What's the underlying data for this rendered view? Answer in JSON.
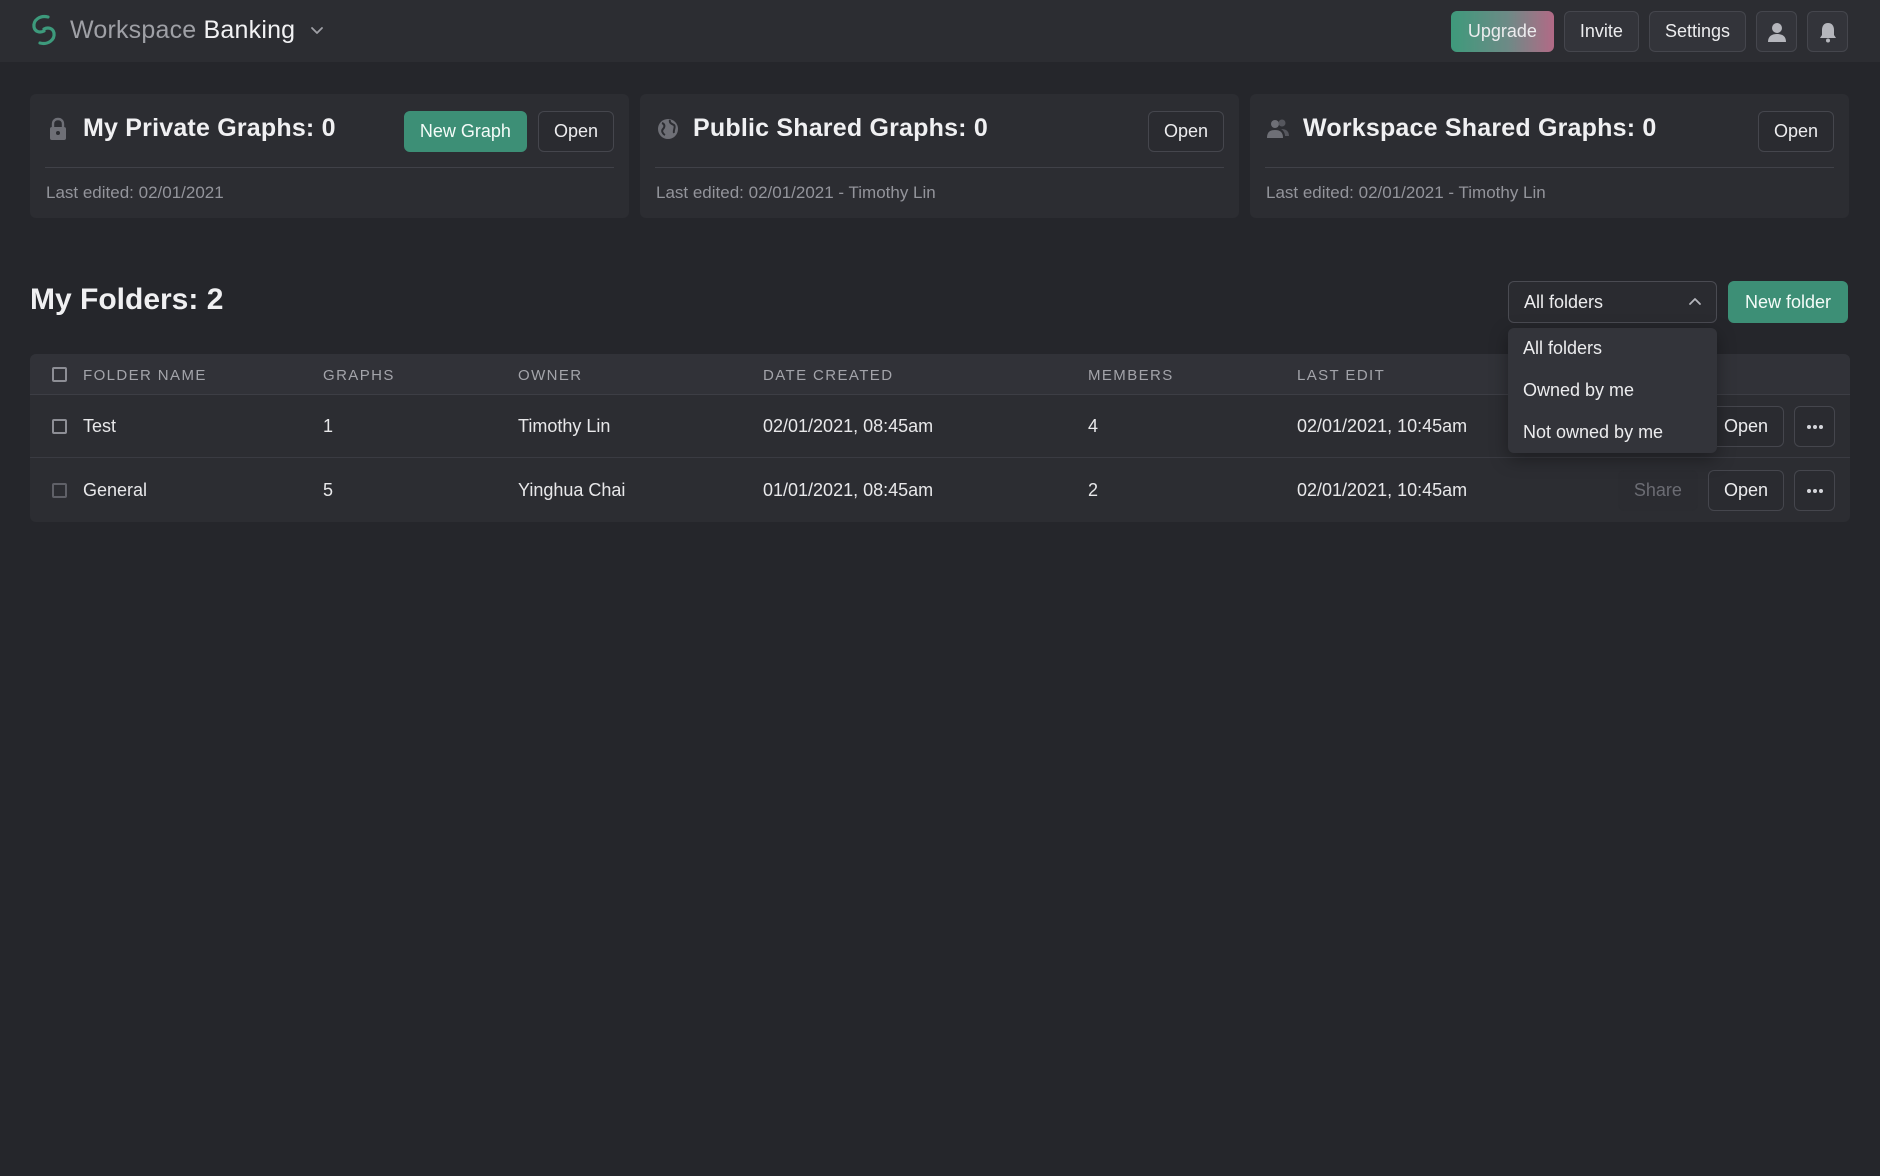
{
  "topbar": {
    "workspace_prefix": "Workspace",
    "workspace_name": "Banking",
    "upgrade_label": "Upgrade",
    "invite_label": "Invite",
    "settings_label": "Settings",
    "icons": [
      "logo-icon",
      "chevron-down-icon",
      "user-icon",
      "bell-icon"
    ]
  },
  "cards": [
    {
      "icon": "lock-icon",
      "title": "My Private Graphs: 0",
      "subtitle": "Last edited: 02/01/2021",
      "new_graph_label": "New Graph",
      "open_label": "Open"
    },
    {
      "icon": "globe-icon",
      "title": "Public Shared Graphs: 0",
      "subtitle": "Last edited: 02/01/2021 - Timothy Lin",
      "open_label": "Open"
    },
    {
      "icon": "users-icon",
      "title": "Workspace Shared Graphs: 0",
      "subtitle": "Last edited: 02/01/2021 - Timothy Lin",
      "open_label": "Open"
    }
  ],
  "folders": {
    "title": "My Folders: 2",
    "filter_value": "All folders",
    "new_folder_label": "New folder",
    "filter_options": [
      "All folders",
      "Owned by me",
      "Not owned by me"
    ],
    "columns": [
      "FOLDER NAME",
      "GRAPHS",
      "OWNER",
      "DATE CREATED",
      "MEMBERS",
      "LAST EDIT"
    ],
    "rows": [
      {
        "name": "Test",
        "graphs": "1",
        "owner": "Timothy Lin",
        "date_created": "02/01/2021, 08:45am",
        "members": "4",
        "last_edit": "02/01/2021, 10:45am",
        "open_label": "Open"
      },
      {
        "name": "General",
        "graphs": "5",
        "owner": "Yinghua Chai",
        "date_created": "01/01/2021, 08:45am",
        "members": "2",
        "last_edit": "02/01/2021, 10:45am",
        "share_label": "Share",
        "open_label": "Open"
      }
    ]
  },
  "colors": {
    "background": "#25262b",
    "surface": "#2c2d32",
    "accent": "#3d8f76",
    "upgrade_gradient_start": "#3e9a7b",
    "upgrade_gradient_end": "#b26a86"
  }
}
